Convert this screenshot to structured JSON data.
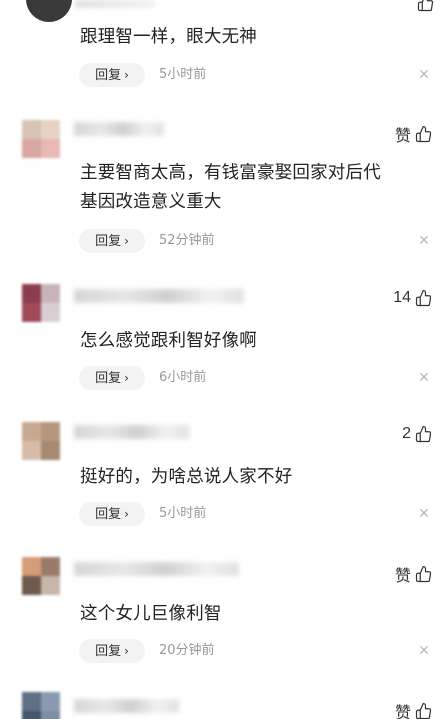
{
  "top_comment": {
    "content": "跟理智一样，眼大无神",
    "reply_label": "回复",
    "time": "5小时前"
  },
  "comments": [
    {
      "like_label": "赞",
      "content_lines": [
        "主要智商太高，有钱富豪娶回家对后代",
        "基因改造意义重大"
      ],
      "reply_label": "回复",
      "time": "52分钟前"
    },
    {
      "like_label": "14",
      "content_lines": [
        "怎么感觉跟利智好像啊"
      ],
      "reply_label": "回复",
      "time": "6小时前"
    },
    {
      "like_label": "2",
      "content_lines": [
        "挺好的，为啥总说人家不好"
      ],
      "reply_label": "回复",
      "time": "5小时前"
    },
    {
      "like_label": "赞",
      "content_lines": [
        "这个女儿巨像利智"
      ],
      "reply_label": "回复",
      "time": "20分钟前"
    },
    {
      "like_label": "赞"
    }
  ],
  "icons": {
    "like": "thumbs-up-outline-icon",
    "reply_arrow": "chevron-right-icon",
    "close": "close-icon"
  },
  "colors": {
    "text": "#222222",
    "muted": "#999999",
    "pill_bg": "#f3f3f3",
    "close": "#bbbbbb"
  }
}
